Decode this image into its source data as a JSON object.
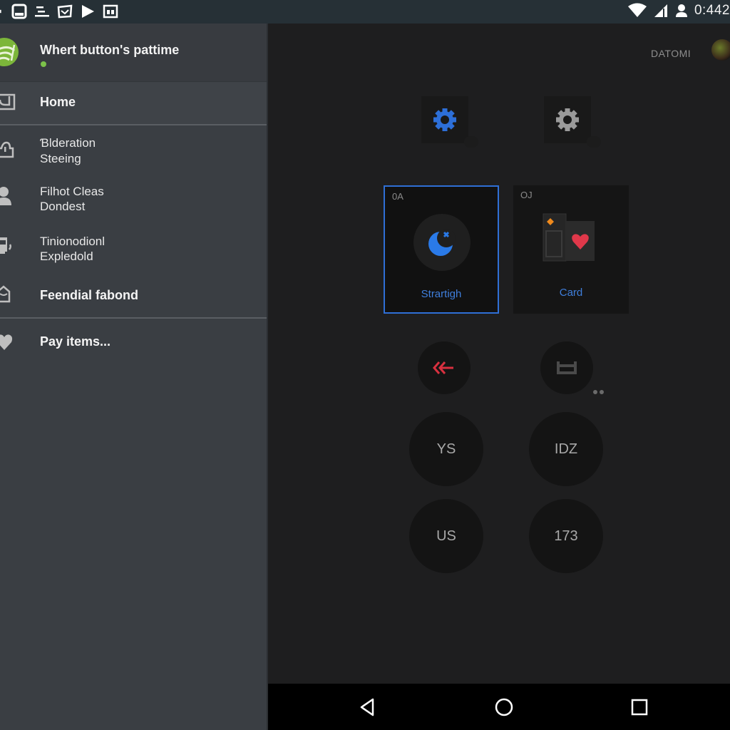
{
  "status_bar": {
    "left_icons": [
      "notification-icon",
      "tablet-icon",
      "list-icon",
      "message-icon",
      "play-icon",
      "image-icon"
    ],
    "right_icons": [
      "wifi-icon",
      "signal-icon",
      "account-icon"
    ],
    "time": "0:442"
  },
  "drawer": {
    "header": {
      "title": "Whert button's pattime",
      "logo": "app-logo-icon",
      "status": "online"
    },
    "items": [
      {
        "icon": "home-icon",
        "lines": [
          "Home"
        ],
        "bold": true,
        "selected": true
      },
      {
        "icon": "upload-icon",
        "lines": [
          "Ɓlderation",
          "Steeing"
        ],
        "bold": false
      },
      {
        "icon": "person-icon",
        "lines": [
          "Filhot Cleas",
          "Dondest"
        ],
        "bold": false
      },
      {
        "icon": "device-icon",
        "lines": [
          "Tinionodionl",
          "Expledold"
        ],
        "bold": false
      },
      {
        "icon": "inbox-icon",
        "lines": [
          "Feendial fabond"
        ],
        "bold": true
      },
      {
        "icon": "heart-icon",
        "lines": [
          "Pay items..."
        ],
        "bold": true
      }
    ]
  },
  "main": {
    "brand": "DATOMI",
    "gear_tiles": [
      {
        "icon": "gear-icon",
        "color": "#2d6fd8"
      },
      {
        "icon": "gear-icon",
        "color": "#9a9a9a"
      }
    ],
    "cards": [
      {
        "number": "0A",
        "label": "Strartigh",
        "icon": "moon-icon",
        "selected": true
      },
      {
        "number": "OJ",
        "label": "Card",
        "icon": "cards-heart-icon",
        "selected": false
      }
    ],
    "action_buttons": [
      {
        "icon": "double-arrow-left-icon",
        "color": "#d8303f"
      },
      {
        "icon": "tray-icon",
        "color": "#4a4a4a"
      }
    ],
    "round_buttons": [
      "YS",
      "IDZ",
      "US",
      "173"
    ]
  },
  "nav_bar": {
    "buttons": [
      "back-icon",
      "home-circle-icon",
      "recents-icon"
    ]
  },
  "colors": {
    "accent_blue": "#2f6fd6",
    "accent_green": "#7cb63a",
    "accent_red": "#d8303f"
  }
}
